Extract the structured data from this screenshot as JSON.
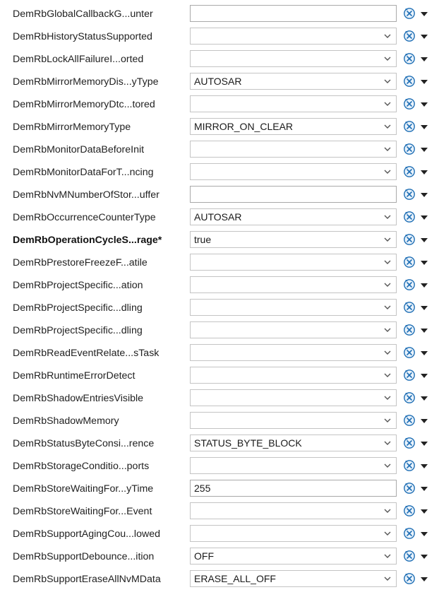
{
  "rows": [
    {
      "label": "DemRbGlobalCallbackG...unter",
      "type": "text",
      "value": ""
    },
    {
      "label": "DemRbHistoryStatusSupported",
      "type": "combo",
      "value": ""
    },
    {
      "label": "DemRbLockAllFailureI...orted",
      "type": "combo",
      "value": ""
    },
    {
      "label": "DemRbMirrorMemoryDis...yType",
      "type": "combo",
      "value": "AUTOSAR"
    },
    {
      "label": "DemRbMirrorMemoryDtc...tored",
      "type": "combo",
      "value": ""
    },
    {
      "label": "DemRbMirrorMemoryType",
      "type": "combo",
      "value": "MIRROR_ON_CLEAR"
    },
    {
      "label": "DemRbMonitorDataBeforeInit",
      "type": "combo",
      "value": ""
    },
    {
      "label": "DemRbMonitorDataForT...ncing",
      "type": "combo",
      "value": ""
    },
    {
      "label": "DemRbNvMNumberOfStor...uffer",
      "type": "text",
      "value": ""
    },
    {
      "label": "DemRbOccurrenceCounterType",
      "type": "combo",
      "value": "AUTOSAR"
    },
    {
      "label": "DemRbOperationCycleS...rage*",
      "type": "combo",
      "value": "true",
      "bold": true
    },
    {
      "label": "DemRbPrestoreFreezeF...atile",
      "type": "combo",
      "value": ""
    },
    {
      "label": "DemRbProjectSpecific...ation",
      "type": "combo",
      "value": ""
    },
    {
      "label": "DemRbProjectSpecific...dling",
      "type": "combo",
      "value": ""
    },
    {
      "label": "DemRbProjectSpecific...dling",
      "type": "combo",
      "value": ""
    },
    {
      "label": "DemRbReadEventRelate...sTask",
      "type": "combo",
      "value": ""
    },
    {
      "label": "DemRbRuntimeErrorDetect",
      "type": "combo",
      "value": ""
    },
    {
      "label": "DemRbShadowEntriesVisible",
      "type": "combo",
      "value": ""
    },
    {
      "label": "DemRbShadowMemory",
      "type": "combo",
      "value": ""
    },
    {
      "label": "DemRbStatusByteConsi...rence",
      "type": "combo",
      "value": "STATUS_BYTE_BLOCK"
    },
    {
      "label": "DemRbStorageConditio...ports",
      "type": "combo",
      "value": ""
    },
    {
      "label": "DemRbStoreWaitingFor...yTime",
      "type": "text",
      "value": "255"
    },
    {
      "label": "DemRbStoreWaitingFor...Event",
      "type": "combo",
      "value": ""
    },
    {
      "label": "DemRbSupportAgingCou...lowed",
      "type": "combo",
      "value": ""
    },
    {
      "label": "DemRbSupportDebounce...ition",
      "type": "combo",
      "value": "OFF"
    },
    {
      "label": "DemRbSupportEraseAllNvMData",
      "type": "combo",
      "value": "ERASE_ALL_OFF"
    }
  ],
  "icons": {
    "dropdown": "chevron-down-icon",
    "reset": "reset-default-icon",
    "menu": "caret-down-icon"
  },
  "colors": {
    "reset_icon": "#1f6fb5",
    "border": "#c4c4c4",
    "text": "#1e1e1e"
  }
}
